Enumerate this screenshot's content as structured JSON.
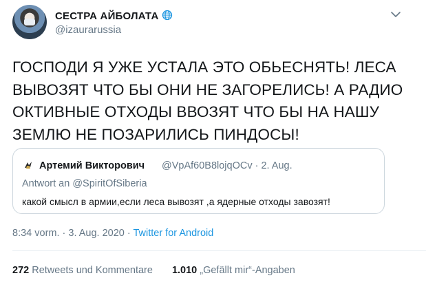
{
  "author": {
    "name": "СЕСТРА АЙБОЛАТА",
    "handle": "@izaurarussia",
    "name_icon": "globe-icon",
    "menu_icon": "chevron-down-icon"
  },
  "tweet": {
    "text": "ГОСПОДИ Я УЖЕ УСТАЛА ЭТО ОБЬЕСНЯТЬ! ЛЕСА ВЫВОЗЯТ ЧТО БЫ ОНИ НЕ ЗАГОРЕЛИСЬ! А РАДИО ОКТИВНЫЕ ОТХОДЫ ВВОЗЯТ ЧТО БЫ НА НАШУ ЗЕМЛЮ НЕ ПОЗАРИЛИСЬ ПИНДОСЫ!"
  },
  "quoted": {
    "name": "Артемий Викторович",
    "handle_date": "@VpAf60B8lojqOCv · 2. Aug.",
    "reply_to": "Antwort an @SpiritOfSiberia",
    "text": "какой смысл в армии,если леса вывозят ,а ядерные отходы завозят!"
  },
  "meta": {
    "datetime": "8:34 vorm. · 3. Aug. 2020 · ",
    "source": "Twitter for Android"
  },
  "stats": {
    "retweets_count": "272",
    "retweets_label": " Retweets und Kommentare",
    "likes_count": "1.010",
    "likes_label": " „Gefällt mir“-Angaben"
  },
  "colors": {
    "text": "#14171a",
    "secondary": "#657786",
    "link": "#1b95e0",
    "border": "#ccd6dd"
  }
}
